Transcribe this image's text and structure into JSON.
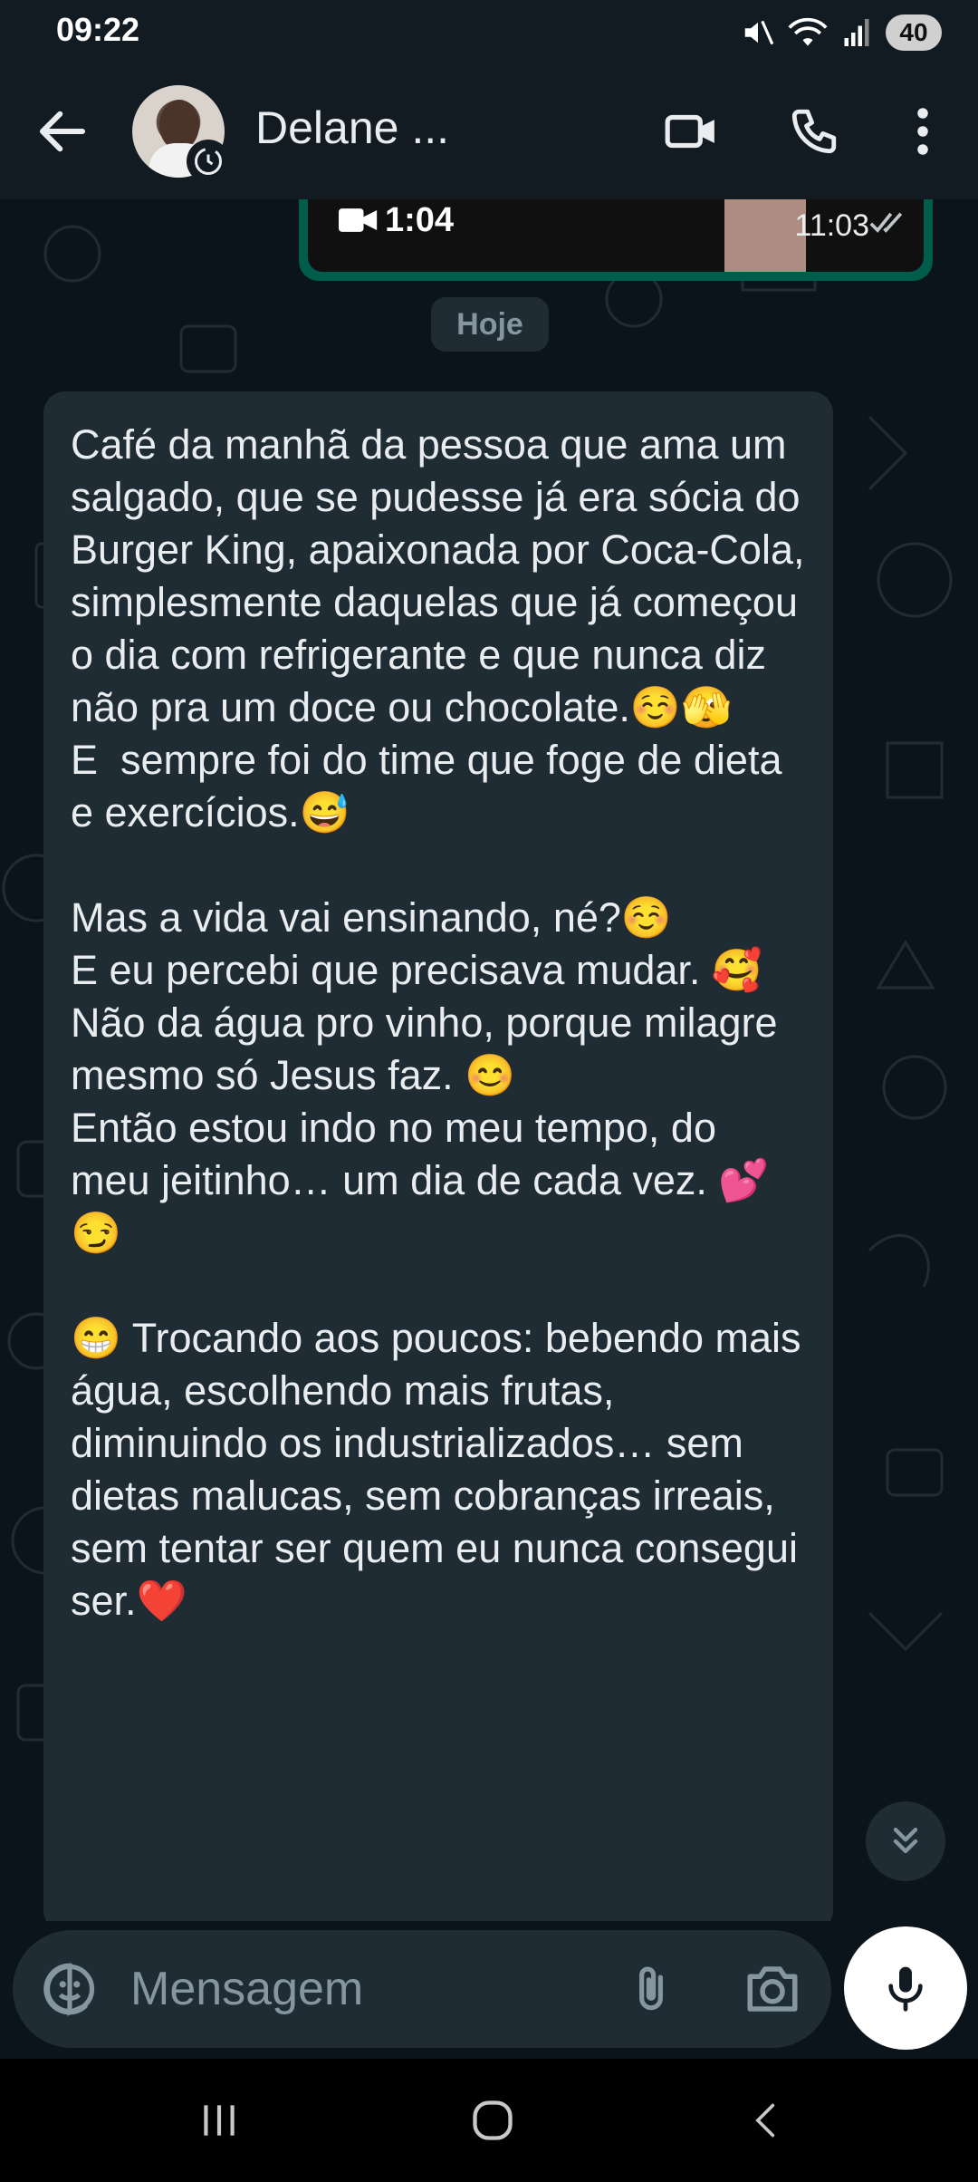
{
  "status_bar": {
    "time": "09:22",
    "battery": "40",
    "icons": [
      "mute-icon",
      "wifi-icon",
      "signal-icon"
    ]
  },
  "header": {
    "contact_name": "Delane ...",
    "icons": [
      "back-arrow-icon",
      "video-call-icon",
      "phone-icon",
      "more-options-icon"
    ]
  },
  "previous_message": {
    "video_duration": "1:04",
    "time": "11:03"
  },
  "date_chip": "Hoje",
  "message": {
    "text": "Café da manhã da pessoa que ama um salgado, que se pudesse já era sócia do Burger King, apaixonada por Coca-Cola, simplesmente daquelas que já começou o dia com refrigerante e que nunca diz não pra um doce ou chocolate.☺️🫣\nE  sempre foi do time que foge de dieta e exercícios.😅\n\nMas a vida vai ensinando, né?☺️\nE eu percebi que precisava mudar. 🥰 Não da água pro vinho, porque milagre mesmo só Jesus faz. 😊\nEntão estou indo no meu tempo, do meu jeitinho… um dia de cada vez. 💕😏\n\n😁 Trocando aos poucos: bebendo mais água, escolhendo mais frutas, diminuindo os industrializados… sem dietas malucas, sem cobranças irreais, sem tentar ser quem eu nunca consegui ser.❤️"
  },
  "composer": {
    "placeholder": "Mensagem"
  },
  "colors": {
    "header_bg": "#121b22",
    "chat_bg": "#0b141a",
    "bubble_bg": "#1f2c34",
    "outgoing_accent": "#005c4b",
    "text_primary": "#e9edef",
    "text_secondary": "#8696a0"
  }
}
